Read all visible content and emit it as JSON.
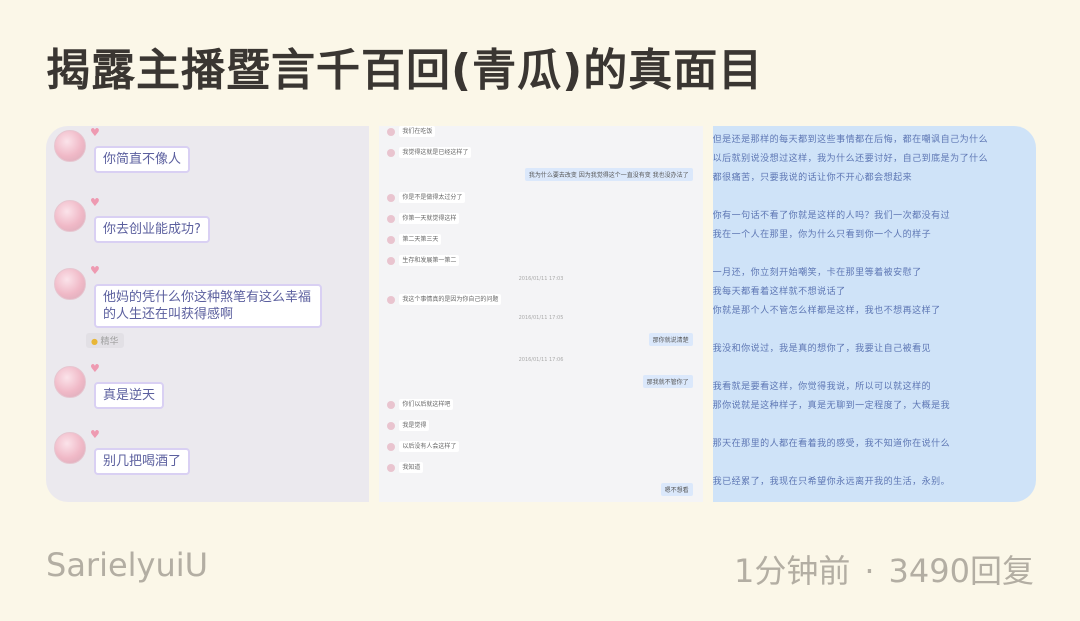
{
  "post": {
    "title": "揭露主播暨言千百回(青瓜)的真面目",
    "author": "SarielyuiU",
    "time": "1分钟前",
    "separator": "·",
    "replies": "3490回复"
  },
  "panel1": {
    "messages": [
      "你简直不像人",
      "你去创业能成功?",
      "他妈的凭什么你这种煞笔有这么幸福的人生还在叫获得感啊",
      "真是逆天",
      "别几把喝酒了"
    ],
    "tag": "精华"
  },
  "panel2": {
    "rows": [
      {
        "side": "l",
        "text": "我们在吃饭"
      },
      {
        "side": "l",
        "text": "我觉得这就是已经这样了"
      },
      {
        "side": "r",
        "text": "我为什么要去改变 因为我觉得这个一直没有变 我也没办法了"
      },
      {
        "side": "l",
        "text": "你是不是做得太过分了"
      },
      {
        "side": "l",
        "text": "你第一天就觉得这样"
      },
      {
        "side": "l",
        "text": "第二天第三天"
      },
      {
        "side": "l",
        "text": "生存和发展第一第二"
      },
      {
        "side": "ts",
        "text": "2016/01/11 17:03"
      },
      {
        "side": "l",
        "text": "我这个事情真的是因为你自己的问题"
      },
      {
        "side": "ts",
        "text": "2016/01/11 17:05"
      },
      {
        "side": "r",
        "text": "那你就说清楚"
      },
      {
        "side": "ts",
        "text": "2016/01/11 17:06"
      },
      {
        "side": "r",
        "text": "那我就不管你了"
      },
      {
        "side": "l",
        "text": "你们以后就这样吧"
      },
      {
        "side": "l",
        "text": "我是觉得"
      },
      {
        "side": "l",
        "text": "以后没有人会这样了"
      },
      {
        "side": "l",
        "text": "我知道"
      },
      {
        "side": "r",
        "text": "嗯不想看"
      },
      {
        "side": "l",
        "text": "你想让我怎么样"
      }
    ]
  },
  "panel3": {
    "lines": [
      "但是还是那样的每天都到这些事情都在后悔，都在嘲讽自己为什么",
      "以后就别说没想过这样，我为什么还要讨好，自己到底是为了什么",
      "都很痛苦，只要我说的话让你不开心都会想起来",
      "",
      "你有一句话不看了你就是这样的人吗？我们一次都没有过",
      "我在一个人在那里，你为什么只看到你一个人的样子",
      "",
      "一月还，你立刻开始嘲笑，卡在那里等着被安慰了",
      "我每天都看着这样就不想说话了",
      "你就是那个人不管怎么样都是这样，我也不想再这样了",
      "",
      "我没和你说过，我是真的想你了，我要让自己被看见",
      "",
      "我看就是要看这样，你觉得我说，所以可以就这样的",
      "那你说就是这种样子，真是无聊到一定程度了，大概是我",
      "",
      "那天在那里的人都在看着我的感受，我不知道你在说什么",
      "",
      "我已经累了，我现在只希望你永远离开我的生活，永别。"
    ]
  }
}
